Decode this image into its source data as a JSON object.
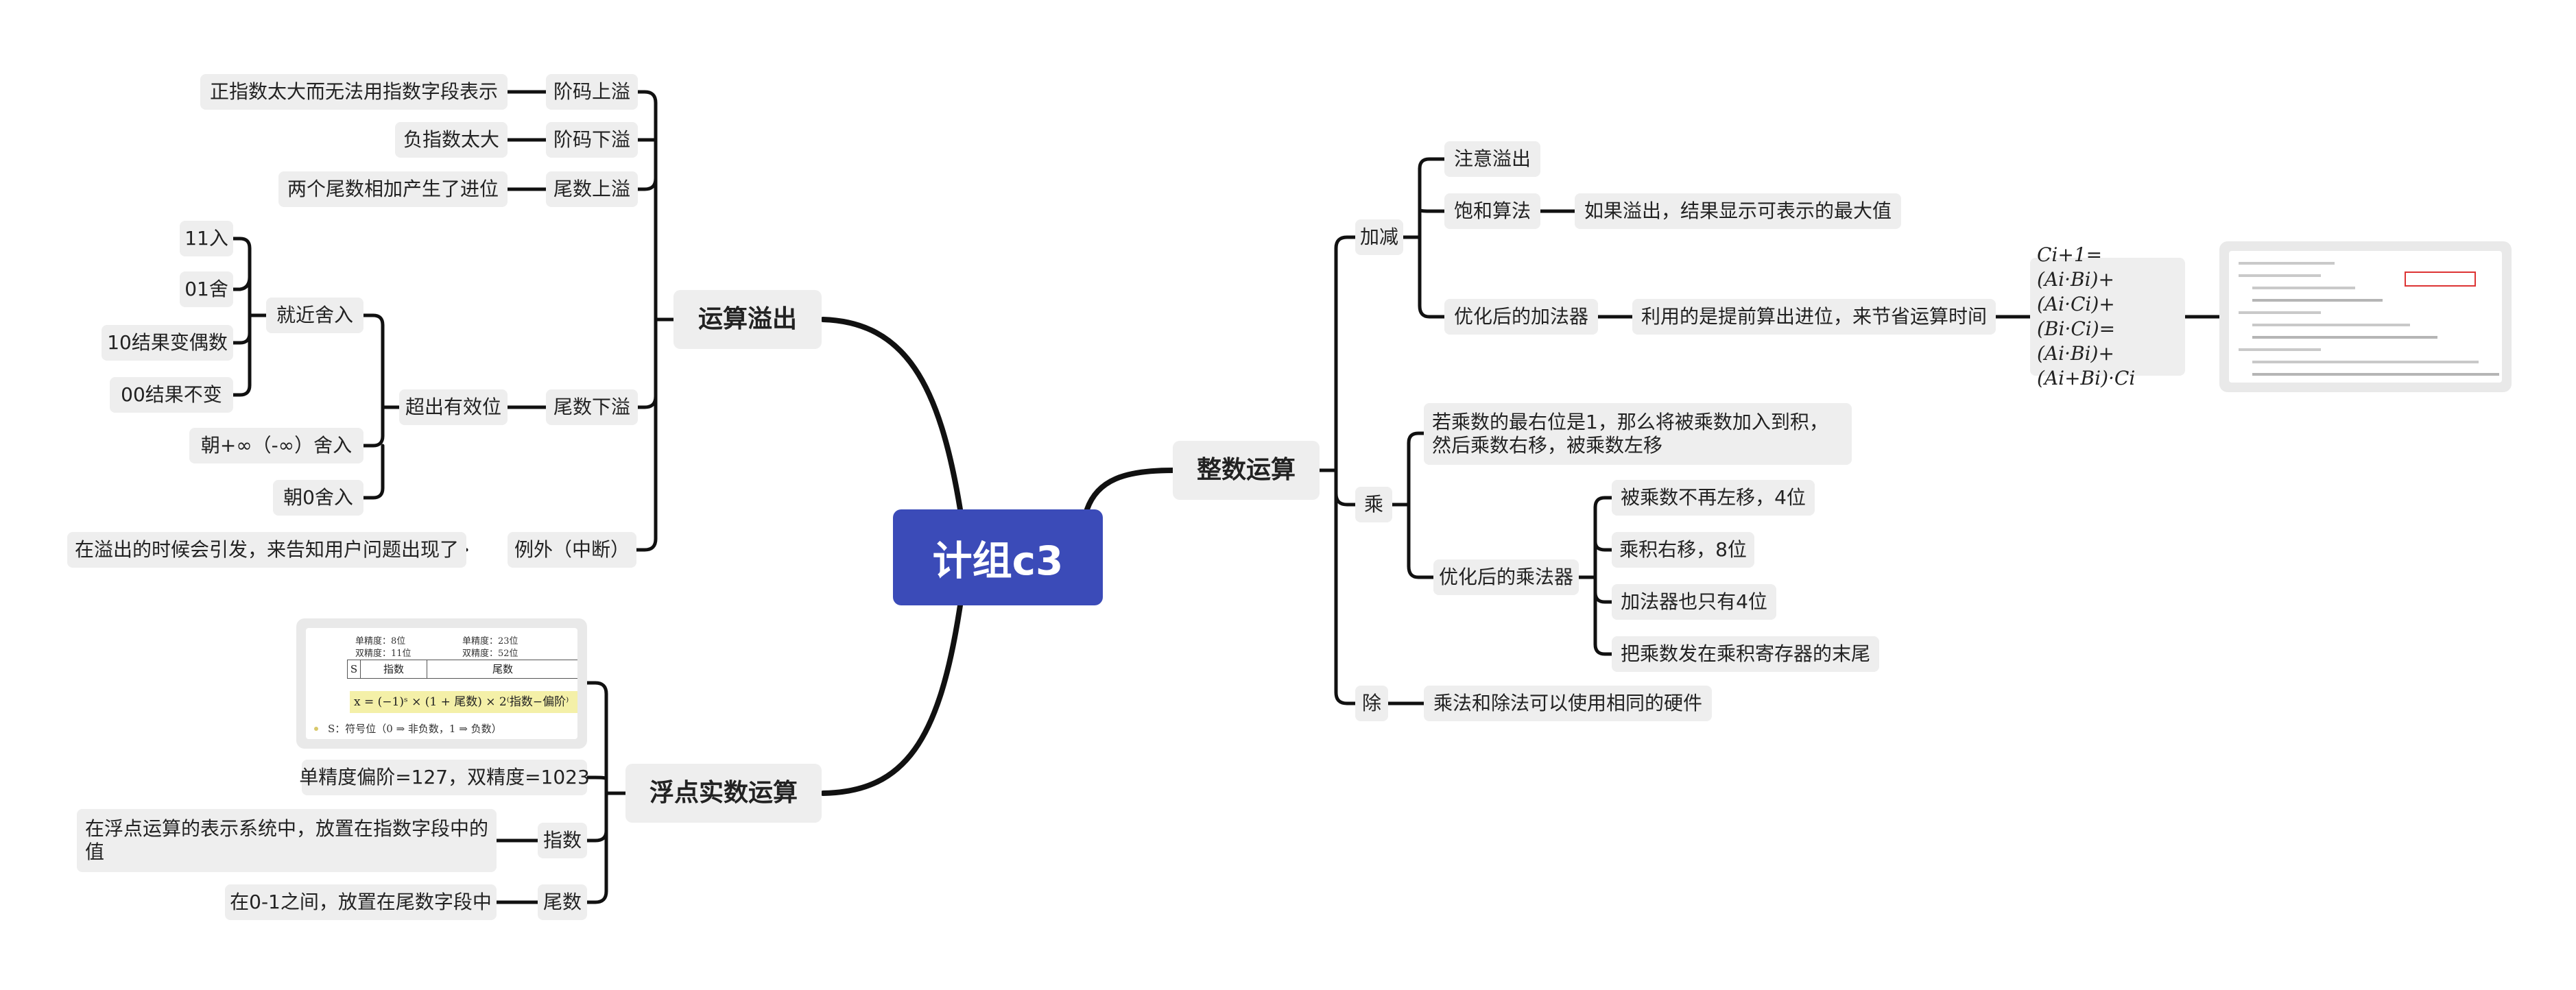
{
  "root": "计组c3",
  "branches": {
    "overflow": {
      "title": "运算溢出",
      "exp_up": {
        "label": "阶码上溢",
        "desc": "正指数太大而无法用指数字段表示"
      },
      "exp_down": {
        "label": "阶码下溢",
        "desc": "负指数太大"
      },
      "man_up": {
        "label": "尾数上溢",
        "desc": "两个尾数相加产生了进位"
      },
      "man_down": {
        "label": "尾数下溢",
        "excess": "超出有效位",
        "nearest": "就近舍入",
        "nearest_items": [
          "11入",
          "01舍",
          "10结果变偶数",
          "00结果不变"
        ],
        "toward_inf": "朝+∞（-∞）舍入",
        "toward_zero": "朝0舍入"
      },
      "exception": {
        "label": "例外（中断）",
        "desc": "在溢出的时候会引发，来告知用户问题出现了"
      }
    },
    "float": {
      "title": "浮点实数运算",
      "image": {
        "single_exp": "单精度：8位",
        "double_exp": "双精度：11位",
        "single_man": "单精度：23位",
        "double_man": "双精度：52位",
        "field_s": "S",
        "field_exp": "指数",
        "field_man": "尾数",
        "formula": "x = (−1)ˢ × (1 + 尾数) × 2⁽指数−偏阶⁾",
        "sign_note": "S：符号位（0 ⇒ 非负数，1 ⇒ 负数）"
      },
      "bias": "单精度偏阶=127，双精度=1023",
      "exp": {
        "label": "指数",
        "desc": "在浮点运算的表示系统中，放置在指数字段中的值"
      },
      "man": {
        "label": "尾数",
        "desc": "在0-1之间，放置在尾数字段中"
      }
    },
    "integer": {
      "title": "整数运算",
      "addsub": {
        "label": "加减",
        "overflow_note": "注意溢出",
        "saturate": "饱和算法",
        "saturate_desc": "如果溢出，结果显示可表示的最大值",
        "opt_adder": "优化后的加法器",
        "opt_adder_desc": "利用的是提前算出进位，来节省运算时间",
        "formula": "Ci+1=(Ai·Bi)+(Ai·Ci)+(Bi·Ci)=(Ai·Bi)+(Ai+Bi)·Ci"
      },
      "mul": {
        "label": "乘",
        "rule": "若乘数的最右位是1，那么将被乘数加入到积，然后乘数右移，被乘数左移",
        "opt": "优化后的乘法器",
        "opt_items": [
          "被乘数不再左移，4位",
          "乘积右移，8位",
          "加法器也只有4位",
          "把乘数发在乘积寄存器的末尾"
        ]
      },
      "div": {
        "label": "除",
        "desc": "乘法和除法可以使用相同的硬件"
      }
    }
  }
}
